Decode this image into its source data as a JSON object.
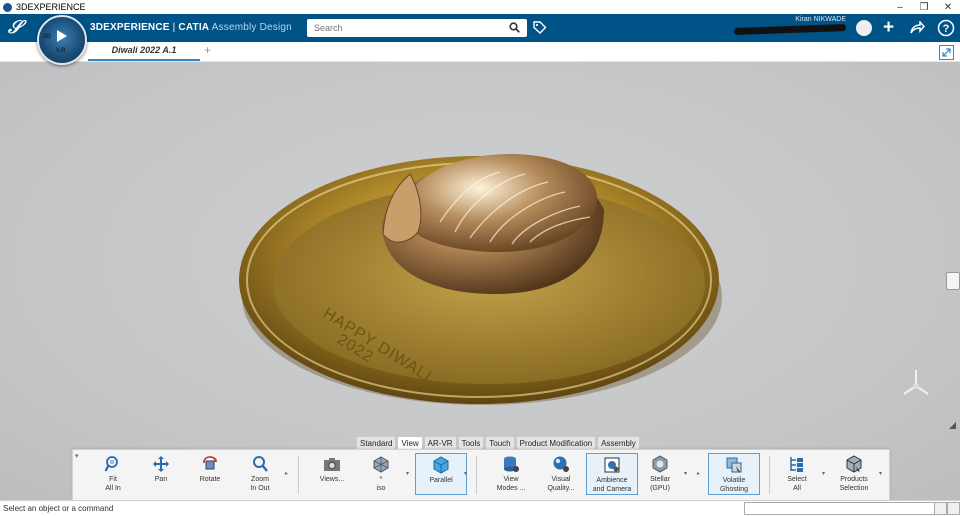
{
  "window": {
    "title": "3DEXPERIENCE",
    "controls": [
      "–",
      "❐",
      "✕"
    ]
  },
  "header": {
    "compass": {
      "label_top": "3D",
      "label_bottom": "V.R"
    },
    "brand_main": "3DEXPERIENCE",
    "brand_sep": " | ",
    "brand_product": "CATIA",
    "brand_app": "Assembly Design",
    "search_placeholder": "Search",
    "user_name": "Kiran NIKWADE"
  },
  "tabs": {
    "document": "Diwali 2022 A.1",
    "add": "+"
  },
  "model": {
    "engraving_line1": "HAPPY DIWALI",
    "engraving_line2": "2022"
  },
  "section_tabs": [
    "Standard",
    "View",
    "AR-VR",
    "Tools",
    "Touch",
    "Product Modification",
    "Assembly"
  ],
  "active_section": "View",
  "commands": [
    {
      "label1": "Fit",
      "label2": "All In",
      "icon": "fit-all-icon"
    },
    {
      "label1": "Pan",
      "label2": "",
      "icon": "pan-icon"
    },
    {
      "label1": "Rotate",
      "label2": "",
      "icon": "rotate-icon"
    },
    {
      "label1": "Zoom",
      "label2": "In Out",
      "icon": "zoom-icon"
    },
    {
      "label1": "Views...",
      "label2": "",
      "icon": "camera-icon"
    },
    {
      "label1": "*",
      "label2": "iso",
      "icon": "iso-view-icon"
    },
    {
      "label1": "Parallel",
      "label2": "",
      "icon": "parallel-cube-icon"
    },
    {
      "label1": "View",
      "label2": "Modes ...",
      "icon": "view-modes-icon"
    },
    {
      "label1": "Visual",
      "label2": "Quality...",
      "icon": "visual-quality-icon"
    },
    {
      "label1": "Ambience",
      "label2": "and Camera",
      "icon": "ambience-camera-icon"
    },
    {
      "label1": "Stellar",
      "label2": "(GPU)",
      "icon": "stellar-icon"
    },
    {
      "label1": "Volatile",
      "label2": "Ghosting",
      "icon": "ghosting-icon"
    },
    {
      "label1": "Select",
      "label2": "All",
      "icon": "select-all-icon"
    },
    {
      "label1": "Products",
      "label2": "Selection",
      "icon": "products-selection-icon"
    }
  ],
  "status": {
    "message": "Select an object or a command",
    "command_value": ""
  },
  "colors": {
    "brand_blue": "#005386",
    "accent": "#2f86c9",
    "gold": "#a6862f",
    "background": "#c9cacc"
  }
}
